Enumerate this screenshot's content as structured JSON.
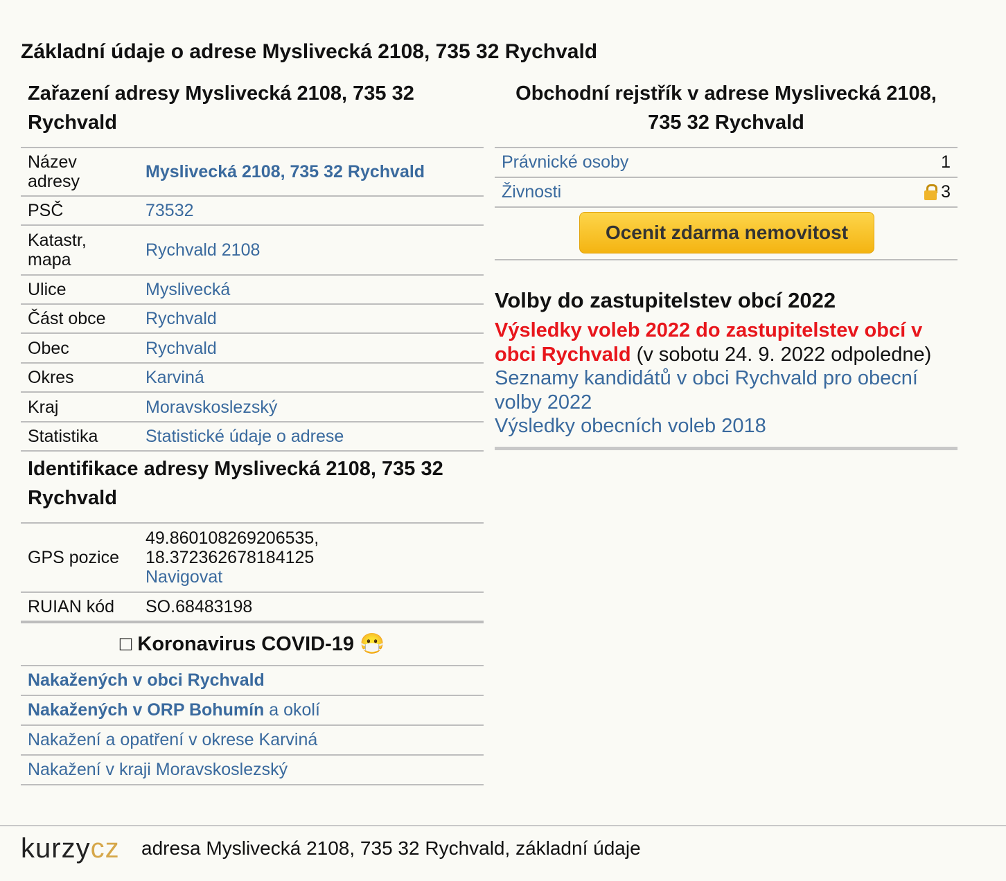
{
  "title": "Základní údaje o adrese Myslivecká 2108, 735 32 Rychvald",
  "zarazeni": {
    "heading": "Zařazení adresy Myslivecká 2108, 735 32 Rychvald",
    "rows": [
      {
        "key": "Název adresy",
        "value": "Myslivecká 2108, 735 32 Rychvald"
      },
      {
        "key": "PSČ",
        "value": "73532"
      },
      {
        "key": "Katastr, mapa",
        "value": "Rychvald 2108"
      },
      {
        "key": "Ulice",
        "value": "Myslivecká"
      },
      {
        "key": "Část obce",
        "value": "Rychvald"
      },
      {
        "key": "Obec",
        "value": "Rychvald"
      },
      {
        "key": "Okres",
        "value": "Karviná"
      },
      {
        "key": "Kraj",
        "value": "Moravskoslezský"
      },
      {
        "key": "Statistika",
        "value": "Statistické údaje o adrese"
      }
    ]
  },
  "identifikace": {
    "heading": "Identifikace adresy Myslivecká 2108, 735 32 Rychvald",
    "gps_key": "GPS pozice",
    "gps_lat": "49.860108269206535,",
    "gps_lon": "18.372362678184125",
    "gps_link": "Navigovat",
    "ruian_key": "RUIAN kód",
    "ruian_value": "SO.68483198"
  },
  "covid": {
    "heading": "Koronavirus COVID-19",
    "icon_left": "□",
    "icon_right": "😷",
    "links": [
      {
        "text": "Nakažených v obci Rychvald",
        "suffix": ""
      },
      {
        "text": "Nakažených v ORP Bohumín",
        "suffix": " a okolí"
      },
      {
        "text": "Nakažení a opatření v okrese Karviná",
        "suffix": ""
      },
      {
        "text": "Nakažení v kraji Moravskoslezský",
        "suffix": ""
      }
    ]
  },
  "rejstrik": {
    "heading": "Obchodní rejstřík v adrese Myslivecká 2108, 735 32 Rychvald",
    "rows": [
      {
        "label": "Právnické osoby",
        "count": "1"
      },
      {
        "label": "Živnosti",
        "count": "3"
      }
    ],
    "button": "Ocenit zdarma nemovitost"
  },
  "volby": {
    "heading": "Volby do zastupitelstev obcí 2022",
    "results_link": "Výsledky voleb 2022 do zastupitelstev obcí v obci Rychvald",
    "results_note": " (v sobotu 24. 9. 2022 odpoledne)",
    "candidates_link": "Seznamy kandidátů v obci Rychvald pro obecní volby 2022",
    "results_2018_link": "Výsledky obecních voleb 2018"
  },
  "footer": {
    "logo_part1": "kurzy",
    "logo_part2": "cz",
    "text": "adresa Myslivecká 2108, 735 32 Rychvald, základní údaje"
  }
}
